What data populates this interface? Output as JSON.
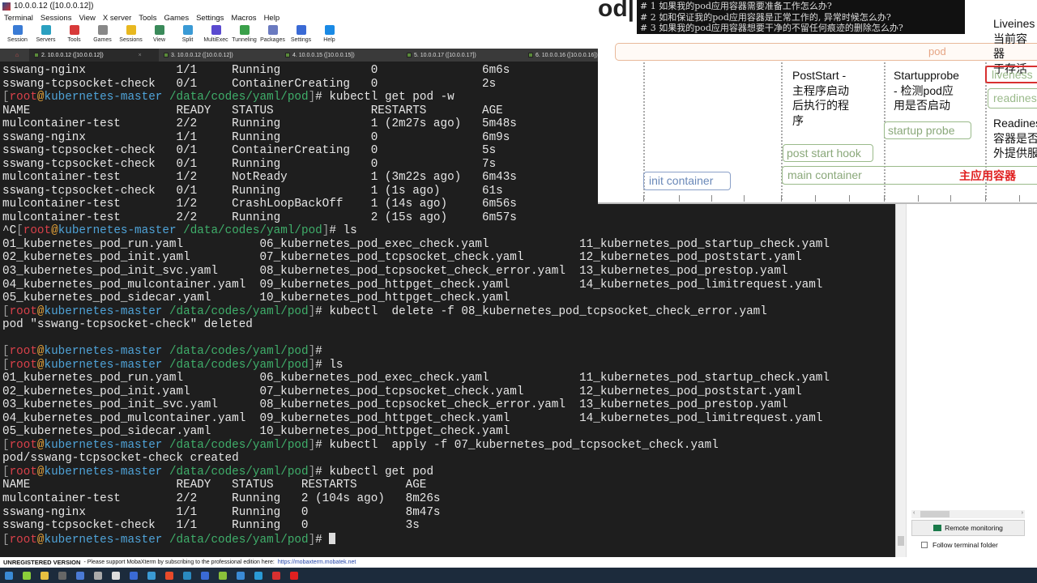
{
  "window": {
    "title": "10.0.0.12 ([10.0.0.12])"
  },
  "menu": [
    "Terminal",
    "Sessions",
    "View",
    "X server",
    "Tools",
    "Games",
    "Settings",
    "Macros",
    "Help"
  ],
  "toolbar": [
    {
      "label": "Session",
      "icon": "session-icon",
      "color": "#3a7bd5"
    },
    {
      "label": "Servers",
      "icon": "servers-icon",
      "color": "#2aa0c0"
    },
    {
      "label": "Tools",
      "icon": "tools-icon",
      "color": "#d83a3a"
    },
    {
      "label": "Games",
      "icon": "games-icon",
      "color": "#888888"
    },
    {
      "label": "Sessions",
      "icon": "star-icon",
      "color": "#e8b820"
    },
    {
      "label": "View",
      "icon": "view-icon",
      "color": "#3a8a5a"
    },
    {
      "label": "Split",
      "icon": "split-icon",
      "color": "#3a9ad5"
    },
    {
      "label": "MultiExec",
      "icon": "multiexec-icon",
      "color": "#5a4ad0"
    },
    {
      "label": "Tunneling",
      "icon": "tunneling-icon",
      "color": "#3aa04a"
    },
    {
      "label": "Packages",
      "icon": "packages-icon",
      "color": "#6a7ac0"
    },
    {
      "label": "Settings",
      "icon": "settings-icon",
      "color": "#3a6ad5"
    },
    {
      "label": "Help",
      "icon": "help-icon",
      "color": "#1a8ae5"
    }
  ],
  "tabs": [
    {
      "label": "2. 10.0.0.12 ([10.0.0.12])",
      "active": true
    },
    {
      "label": "3. 10.0.0.12 ([10.0.0.12])"
    },
    {
      "label": "4. 10.0.0.15 ([10.0.0.15])"
    },
    {
      "label": "5. 10.0.0.17 ([10.0.0.17])"
    },
    {
      "label": "6. 10.0.0.16 ([10.0.0.16])"
    }
  ],
  "prompt": {
    "user": "root",
    "host": "kubernetes-master",
    "path": "/data/codes/yaml/pod"
  },
  "terminal": [
    {
      "t": "sswang-nginx             1/1     Running             0               6m6s"
    },
    {
      "t": "sswang-tcpsocket-check   0/1     ContainerCreating   0               2s"
    },
    {
      "cmd": "kubectl get pod -w"
    },
    {
      "t": "NAME                     READY   STATUS              RESTARTS        AGE"
    },
    {
      "t": "mulcontainer-test        2/2     Running             1 (2m27s ago)   5m48s"
    },
    {
      "t": "sswang-nginx             1/1     Running             0               6m9s"
    },
    {
      "t": "sswang-tcpsocket-check   0/1     ContainerCreating   0               5s"
    },
    {
      "t": "sswang-tcpsocket-check   0/1     Running             0               7s"
    },
    {
      "t": "mulcontainer-test        1/2     NotReady            1 (3m22s ago)   6m43s"
    },
    {
      "t": "sswang-tcpsocket-check   0/1     Running             1 (1s ago)      61s"
    },
    {
      "t": "mulcontainer-test        1/2     CrashLoopBackOff    1 (14s ago)     6m56s"
    },
    {
      "t": "mulcontainer-test        2/2     Running             2 (15s ago)     6m57s"
    },
    {
      "pre": "^C",
      "cmd": "ls"
    },
    {
      "t": "01_kubernetes_pod_run.yaml           06_kubernetes_pod_exec_check.yaml             11_kubernetes_pod_startup_check.yaml"
    },
    {
      "t": "02_kubernetes_pod_init.yaml          07_kubernetes_pod_tcpsocket_check.yaml        12_kubernetes_pod_poststart.yaml"
    },
    {
      "t": "03_kubernetes_pod_init_svc.yaml      08_kubernetes_pod_tcpsocket_check_error.yaml  13_kubernetes_pod_prestop.yaml"
    },
    {
      "t": "04_kubernetes_pod_mulcontainer.yaml  09_kubernetes_pod_httpget_check.yaml          14_kubernetes_pod_limitrequest.yaml"
    },
    {
      "t": "05_kubernetes_pod_sidecar.yaml       10_kubernetes_pod_httpget_check.yaml"
    },
    {
      "cmd": "kubectl  delete -f 08_kubernetes_pod_tcpsocket_check_error.yaml"
    },
    {
      "t": "pod \"sswang-tcpsocket-check\" deleted"
    },
    {
      "t": ""
    },
    {
      "cmd": ""
    },
    {
      "cmd": "ls"
    },
    {
      "t": "01_kubernetes_pod_run.yaml           06_kubernetes_pod_exec_check.yaml             11_kubernetes_pod_startup_check.yaml"
    },
    {
      "t": "02_kubernetes_pod_init.yaml          07_kubernetes_pod_tcpsocket_check.yaml        12_kubernetes_pod_poststart.yaml"
    },
    {
      "t": "03_kubernetes_pod_init_svc.yaml      08_kubernetes_pod_tcpsocket_check_error.yaml  13_kubernetes_pod_prestop.yaml"
    },
    {
      "t": "04_kubernetes_pod_mulcontainer.yaml  09_kubernetes_pod_httpget_check.yaml          14_kubernetes_pod_limitrequest.yaml"
    },
    {
      "t": "05_kubernetes_pod_sidecar.yaml       10_kubernetes_pod_httpget_check.yaml"
    },
    {
      "cmd": "kubectl  apply -f 07_kubernetes_pod_tcpsocket_check.yaml"
    },
    {
      "t": "pod/sswang-tcpsocket-check created"
    },
    {
      "cmd": "kubectl get pod"
    },
    {
      "t": "NAME                     READY   STATUS    RESTARTS       AGE"
    },
    {
      "t": "mulcontainer-test        2/2     Running   2 (104s ago)   8m26s"
    },
    {
      "t": "sswang-nginx             1/1     Running   0              8m47s"
    },
    {
      "t": "sswang-tcpsocket-check   1/1     Running   0              3s"
    },
    {
      "cmd": "",
      "cursor": true
    }
  ],
  "side": {
    "remote_monitoring": "Remote monitoring",
    "follow_folder": "Follow terminal folder"
  },
  "status": {
    "unregistered": "UNREGISTERED VERSION",
    "message": "-  Please support MobaXterm by subscribing to the professional edition here:",
    "link": "https://mobaxterm.mobatek.net"
  },
  "taskbar": [
    "#3a8ad5",
    "#8acf3a",
    "#e8c040",
    "#666666",
    "#4a7ad5",
    "#aaaaaa",
    "#dddddd",
    "#3a6ad5",
    "#3a9ad5",
    "#e84a2a",
    "#2a8ac0",
    "#3a6ad5",
    "#8ac03a",
    "#3a8ad5",
    "#2a9ad5",
    "#d83030",
    "#e02020"
  ],
  "overlay": {
    "title": "od|",
    "questions": [
      "# 1 如果我的pod应用容器需要准备工作怎么办?",
      "# 2 如和保证我的pod应用容器是正常工作的, 异常时候怎么办?",
      "# 3 如果我的pod应用容器想要干净的不留任何痕迹的删除怎么办?"
    ],
    "pod_label": "pod",
    "poststart_desc": [
      "PostStart -",
      "主程序启动",
      "后执行的程",
      "序"
    ],
    "startup_desc": [
      "Startupprobe",
      "- 检测pod应",
      "用是否启动"
    ],
    "liveness_desc": [
      "Liveines",
      "当前容器",
      "于存活"
    ],
    "readiness_desc": [
      "Readines",
      "容器是否",
      "外提供服"
    ],
    "init_container": "init container",
    "post_start_hook": "post start hook",
    "startup_probe": "startup probe",
    "main_container": "main container",
    "main_container_zh": "主应用容器",
    "liveness": "liveness",
    "readiness": "readines"
  }
}
